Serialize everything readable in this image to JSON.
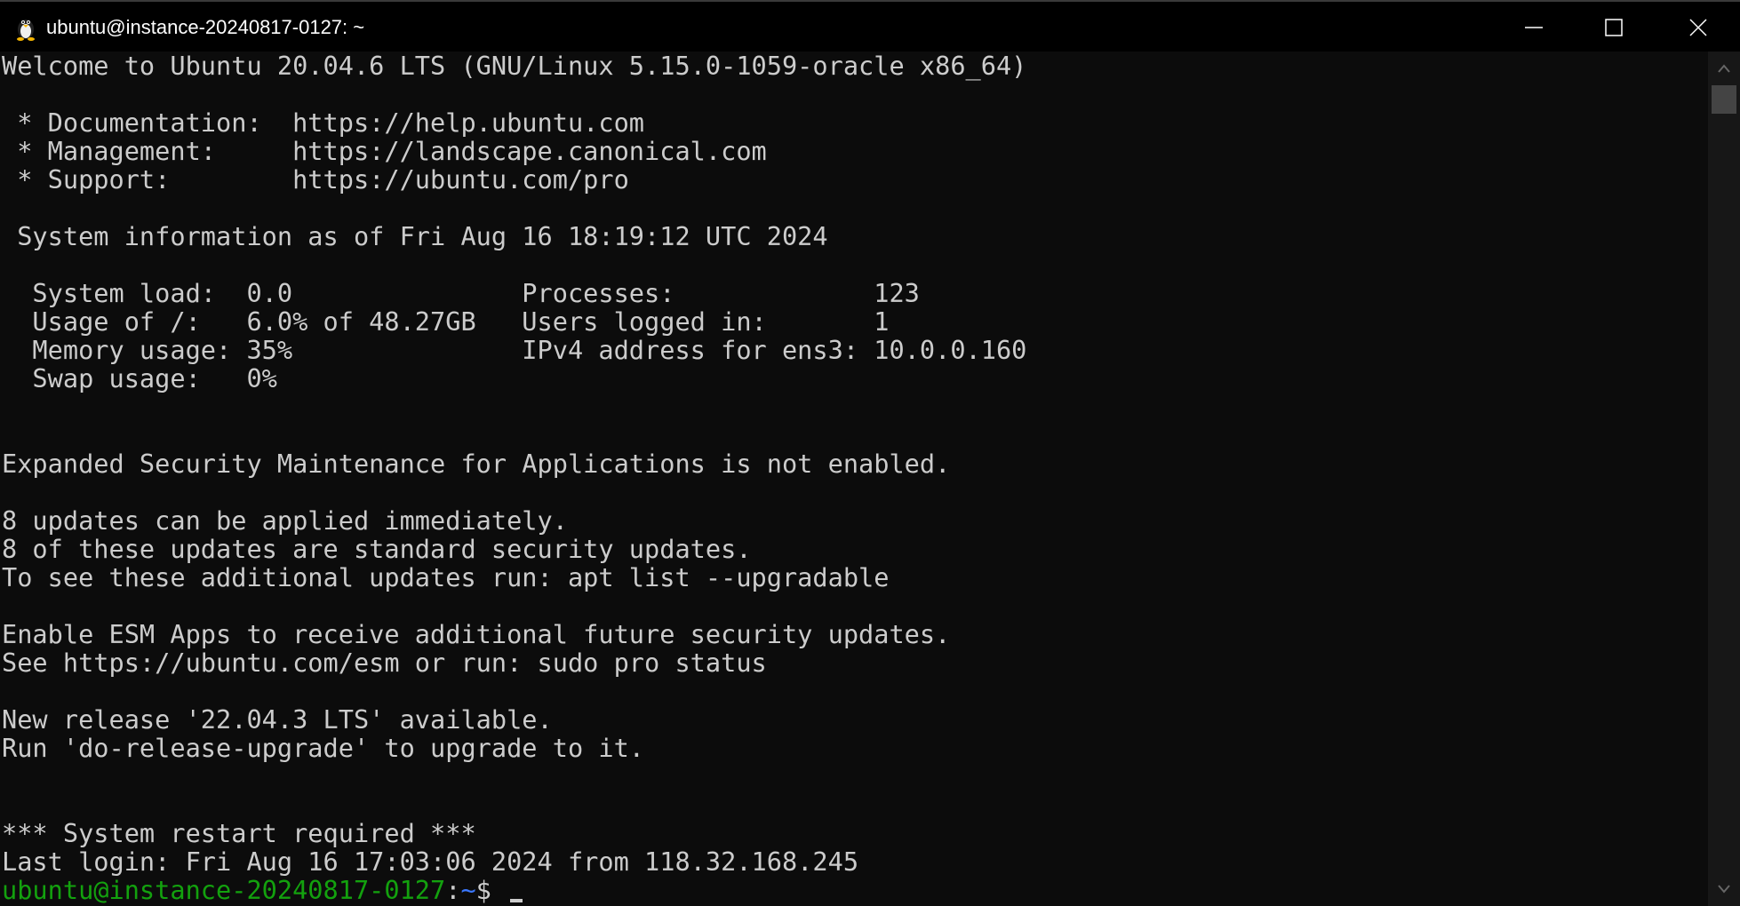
{
  "window": {
    "title": "ubuntu@instance-20240817-0127: ~",
    "app_icon": "tux-penguin-icon"
  },
  "terminal": {
    "lines": [
      "Welcome to Ubuntu 20.04.6 LTS (GNU/Linux 5.15.0-1059-oracle x86_64)",
      "",
      " * Documentation:  https://help.ubuntu.com",
      " * Management:     https://landscape.canonical.com",
      " * Support:        https://ubuntu.com/pro",
      "",
      " System information as of Fri Aug 16 18:19:12 UTC 2024",
      "",
      "  System load:  0.0               Processes:             123",
      "  Usage of /:   6.0% of 48.27GB   Users logged in:       1",
      "  Memory usage: 35%               IPv4 address for ens3: 10.0.0.160",
      "  Swap usage:   0%",
      "",
      "",
      "Expanded Security Maintenance for Applications is not enabled.",
      "",
      "8 updates can be applied immediately.",
      "8 of these updates are standard security updates.",
      "To see these additional updates run: apt list --upgradable",
      "",
      "Enable ESM Apps to receive additional future security updates.",
      "See https://ubuntu.com/esm or run: sudo pro status",
      "",
      "New release '22.04.3 LTS' available.",
      "Run 'do-release-upgrade' to upgrade to it.",
      "",
      "",
      "*** System restart required ***",
      "Last login: Fri Aug 16 17:03:06 2024 from 118.32.168.245"
    ],
    "prompt": {
      "user_host": "ubuntu@instance-20240817-0127",
      "separator": ":",
      "path": "~",
      "symbol": "$ "
    }
  },
  "colors": {
    "background": "#0c0c0c",
    "text": "#cccccc",
    "prompt_user": "#13a10e",
    "prompt_path": "#3b78ff"
  }
}
